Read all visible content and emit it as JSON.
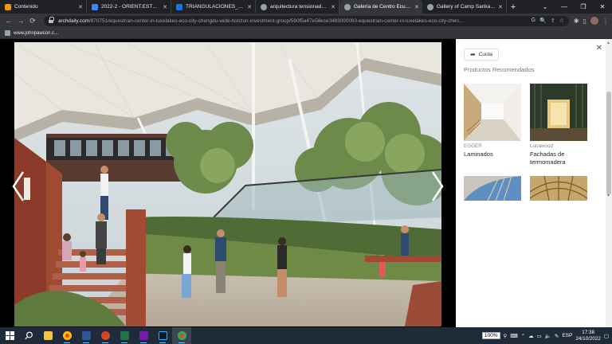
{
  "tabs": [
    {
      "label": "Contenido",
      "color": "#f29900",
      "active": false
    },
    {
      "label": "2022-2 - ORIENT.ESTRUCT",
      "color": "#4285f4",
      "active": false
    },
    {
      "label": "TRIANGULACIONES_GRUP",
      "color": "#1a73e8",
      "active": false
    },
    {
      "label": "arquitectura tensionada ar",
      "color": "#9aa0a6",
      "active": false
    },
    {
      "label": "Galería de Centro Ecuestre",
      "color": "#9aa0a6",
      "active": true
    },
    {
      "label": "Gallery of Camp Sarika / Ar",
      "color": "#9aa0a6",
      "active": false
    }
  ],
  "new_tab": "+",
  "window_controls": {
    "collapse": "⌄",
    "minimize": "—",
    "maximize": "❐",
    "close": "✕"
  },
  "nav": {
    "back": "←",
    "forward": "→",
    "reload": "⟳"
  },
  "address": {
    "domain": "archdaily.com",
    "path": "/870751/equestrian-center-in-luxelakes-eco-city-chengdu-wide-horizon-investment-group/590f5a47e58ece3483000093-equestrian-center-in-luxelakes-eco-city-chen..."
  },
  "bookmarks": [
    {
      "label": "www.johnpawson.c..."
    }
  ],
  "panel": {
    "share_label": "Cuota",
    "close": "✕",
    "recommended_title": "Productos Recomendados",
    "products": [
      {
        "brand": "EGGER",
        "name": "Laminados"
      },
      {
        "brand": "Lunawood",
        "name": "Fachadas de termomadera"
      }
    ]
  },
  "taskbar": {
    "apps": [
      {
        "name": "start",
        "color": "#ffffff"
      },
      {
        "name": "search",
        "color": "#ffffff"
      },
      {
        "name": "file-explorer",
        "color": "#f5c242"
      },
      {
        "name": "chrome",
        "color": "#e94235"
      },
      {
        "name": "word",
        "color": "#2b579a"
      },
      {
        "name": "powerpoint",
        "color": "#d24726"
      },
      {
        "name": "excel",
        "color": "#217346"
      },
      {
        "name": "onenote",
        "color": "#7719aa"
      },
      {
        "name": "photoshop",
        "color": "#001e36"
      },
      {
        "name": "chrome-active",
        "color": "#e94235"
      }
    ],
    "zoom": "100%",
    "lang": "ESP",
    "time": "17:38",
    "date": "24/10/2022"
  }
}
